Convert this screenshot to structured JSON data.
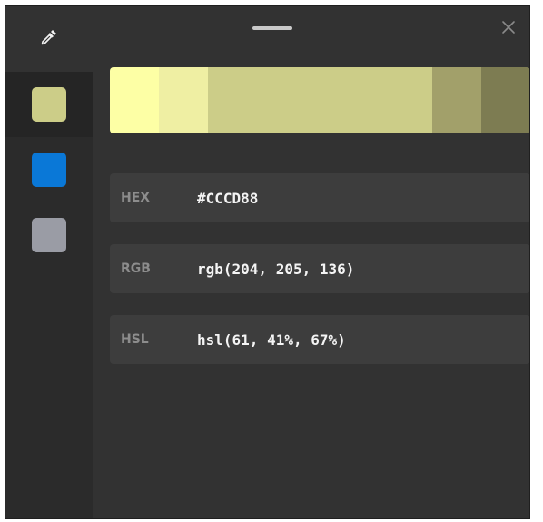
{
  "icons": {
    "picker": "eyedropper-icon",
    "close": "close-icon",
    "drag": "drag-handle"
  },
  "sidebar": {
    "swatches": [
      {
        "color": "#CCCD88",
        "selected": true
      },
      {
        "color": "#0A78D7",
        "selected": false
      },
      {
        "color": "#9A9CA5",
        "selected": false
      }
    ]
  },
  "shades": [
    "#FDFFA5",
    "#EFEFA3",
    "#CCCD88",
    "#A2A06A",
    "#7D7C52"
  ],
  "values": [
    {
      "label": "HEX",
      "value": "#CCCD88"
    },
    {
      "label": "RGB",
      "value": "rgb(204, 205, 136)"
    },
    {
      "label": "HSL",
      "value": "hsl(61, 41%, 67%)"
    }
  ]
}
